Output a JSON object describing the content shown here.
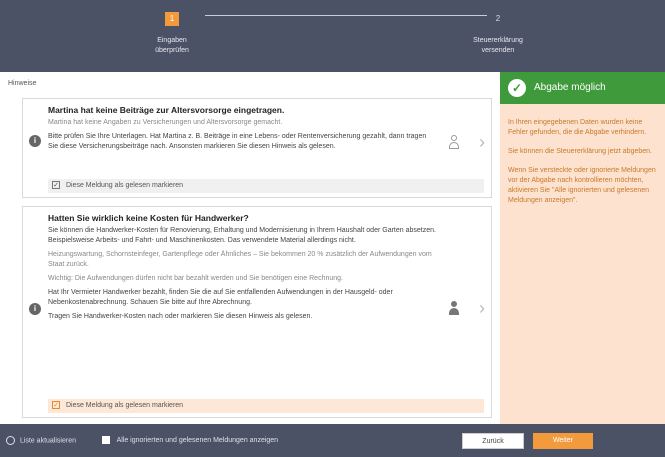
{
  "stepper": {
    "step1": {
      "number": "1",
      "label_line1": "Eingaben",
      "label_line2": "überprüfen"
    },
    "step2": {
      "number": "2",
      "label_line1": "Steuererklärung",
      "label_line2": "versenden"
    }
  },
  "section_title": "Hinweise",
  "cards": [
    {
      "title": "Martina hat keine Beiträge zur Altersvorsorge eingetragen.",
      "paragraphs": [
        "Martina hat keine Angaben zu Versicherungen und Altersvorsorge gemacht.",
        "Bitte prüfen Sie Ihre Unterlagen. Hat Martina z. B. Beiträge in eine Lebens- oder Rentenversicherung gezahlt, dann tragen Sie diese Versicherungsbeiträge nach. Ansonsten markieren Sie diesen Hinweis als gelesen."
      ],
      "mark_label": "Diese Meldung als gelesen markieren",
      "checkbox_mark": "✓"
    },
    {
      "title": "Hatten Sie wirklich keine Kosten für Handwerker?",
      "paragraphs": [
        "Sie können die Handwerker-Kosten für Renovierung, Erhaltung und Modernisierung in Ihrem Haushalt oder Garten absetzen. Beispielsweise Arbeits- und Fahrt- und Maschinenkosten. Das verwendete Material allerdings nicht.",
        "Heizungswartung, Schornsteinfeger, Gartenpflege oder Ähnliches – Sie bekommen 20 % zusätzlich der Aufwendungen vom Staat zurück.",
        "Wichtig: Die Aufwendungen dürfen nicht bar bezahlt werden und Sie benötigen eine Rechnung.",
        "Hat Ihr Vermieter Handwerker bezahlt, finden Sie die auf Sie entfallenden Aufwendungen in der Hausgeld- oder Nebenkostenabrechnung. Schauen Sie bitte auf Ihre Abrechnung.",
        "Tragen Sie Handwerker-Kosten nach oder markieren Sie diesen Hinweis als gelesen."
      ],
      "mark_label": "Diese Meldung als gelesen markieren",
      "checkbox_mark": "✓"
    }
  ],
  "side_panel": {
    "title": "Abgabe möglich",
    "paragraphs": [
      "In Ihren eingegebenen Daten wurden keine Fehler gefunden, die die Abgabe verhindern.",
      "Sie können die Steuererklärung jetzt abgeben.",
      "Wenn Sie versteckte oder ignorierte Meldungen vor der Abgabe nach kontrollieren möchten, aktivieren Sie \"Alle ignorierten und gelesenen Meldungen anzeigen\"."
    ]
  },
  "bottom_bar": {
    "refresh_label": "Liste aktualisieren",
    "show_ignored_label": "Alle ignorierten und gelesenen Meldungen anzeigen",
    "back_label": "Zurück",
    "next_label": "Weiter"
  },
  "icons": {
    "info": "i",
    "check": "✓",
    "chevron": "›"
  },
  "colors": {
    "header_bg": "#4c5266",
    "accent_orange": "#f39a3c",
    "success_green": "#3f9a3b",
    "side_bg": "#fde2cf"
  }
}
